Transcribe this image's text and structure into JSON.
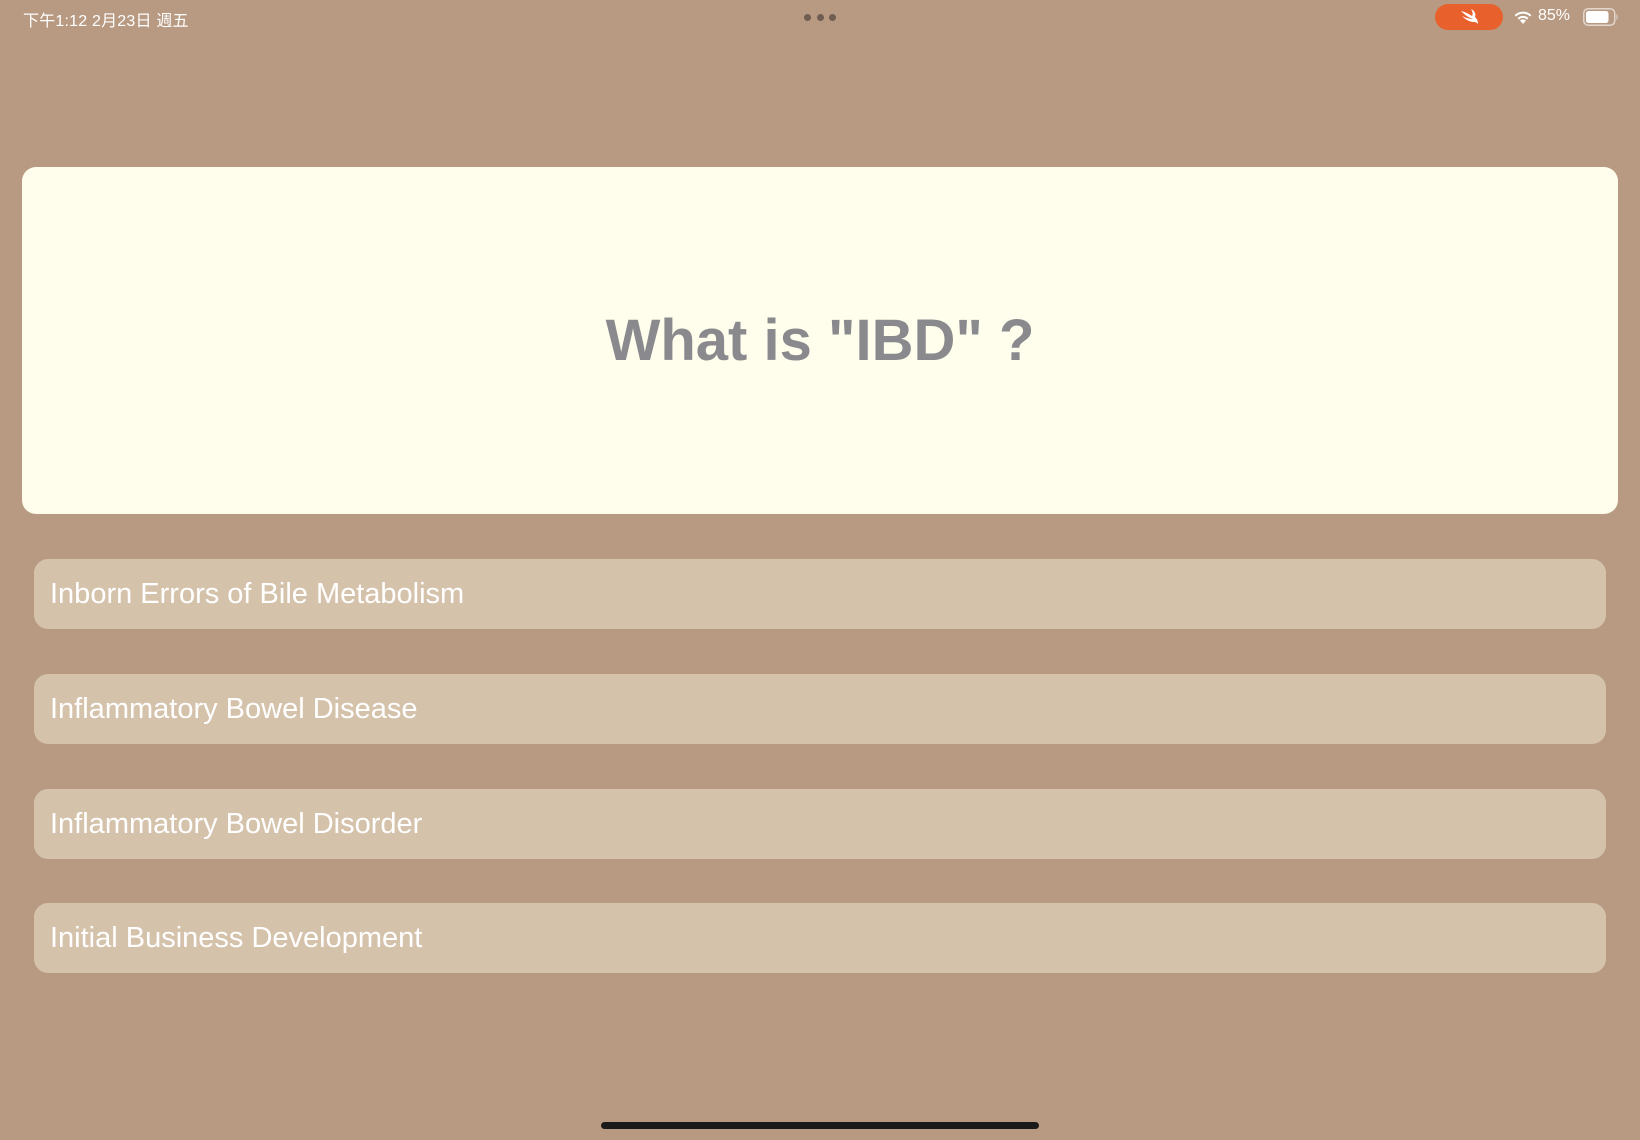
{
  "status_bar": {
    "time_date": "下午1:12   2月23日 週五",
    "battery_percent": "85%",
    "battery_level": 0.85,
    "wifi_icon": "wifi-icon",
    "swift_icon": "swift-playgrounds-icon",
    "accent_color": "#e8612c"
  },
  "question": {
    "text": "What is \"IBD\" ?"
  },
  "answers": [
    {
      "label": "Inborn Errors of Bile Metabolism"
    },
    {
      "label": "Inflammatory Bowel Disease"
    },
    {
      "label": "Inflammatory Bowel Disorder"
    },
    {
      "label": "Initial Business Development"
    }
  ],
  "colors": {
    "background": "#b89a82",
    "card": "#fffeec",
    "option": "#d5c2ab",
    "question_text": "#8a8a8e",
    "option_text": "#ffffff"
  }
}
